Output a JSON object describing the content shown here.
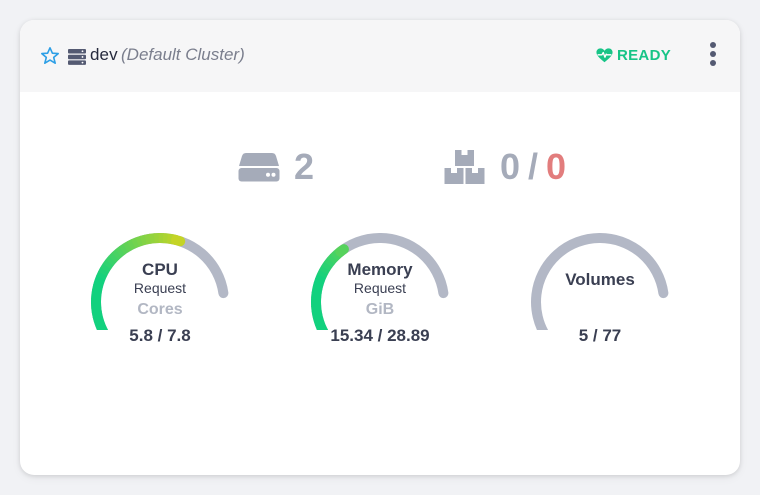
{
  "header": {
    "cluster_name": "dev",
    "cluster_subtitle": "(Default Cluster)",
    "status": "READY",
    "status_color": "#17c487",
    "icons": [
      "star-icon",
      "server-icon",
      "heartbeat-icon",
      "more-vertical-icon"
    ]
  },
  "stats": {
    "nodes": {
      "icon": "hard-drive-icon",
      "value": "2"
    },
    "pods": {
      "icon": "boxes-icon",
      "value": "0",
      "separator": "/",
      "failed": "0",
      "failed_color": "#e27d7d"
    }
  },
  "gauges": {
    "cpu": {
      "title": "CPU",
      "subtitle": "Request",
      "unit": "Cores",
      "value": "5.8 / 7.8",
      "used": 5.8,
      "total": 7.8
    },
    "memory": {
      "title": "Memory",
      "subtitle": "Request",
      "unit": "GiB",
      "value": "15.34 / 28.89",
      "used": 15.34,
      "total": 28.89
    },
    "volumes": {
      "title": "Volumes",
      "value": "5 / 77",
      "used": 5,
      "total": 77
    }
  },
  "colors": {
    "gauge_track": "#b3b8c6",
    "gauge_green": "#12d17e",
    "gauge_yellow": "#c7d424"
  }
}
